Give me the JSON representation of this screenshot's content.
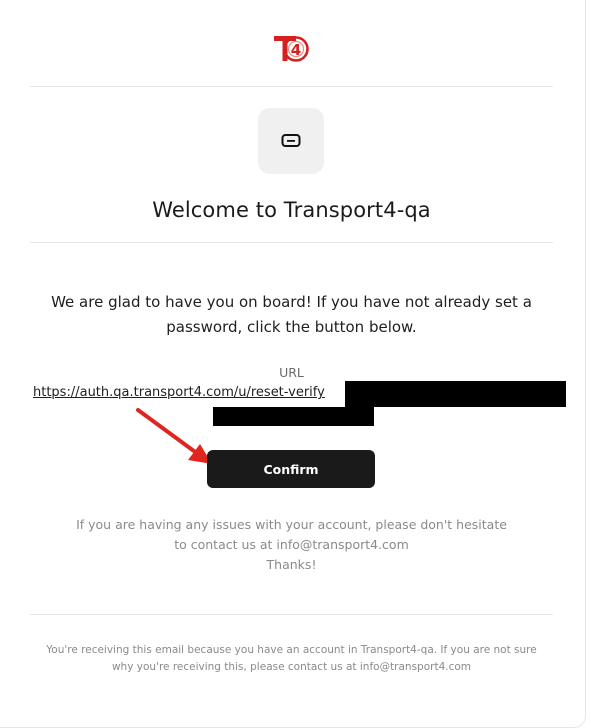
{
  "email": {
    "logo_text": "T4",
    "title": "Welcome to Transport4-qa",
    "intro": "We are glad to have you on board! If you have not already set a password, click the button below.",
    "url_label": "URL",
    "url_text": "https://auth.qa.transport4.com/u/reset-verify",
    "confirm_label": "Confirm",
    "issues_line1": "If you are having any issues with your account, please don't hesitate",
    "issues_line2": "to contact us at info@transport4.com",
    "issues_line3": "Thanks!",
    "footer_line1": "You're receiving this email because you have an account in Transport4-qa. If you are not sure",
    "footer_line2": "why you're receiving this, please contact us at info@transport4.com"
  },
  "icons": {
    "logo": "t4-logo-icon",
    "tile": "chat-bubble-icon",
    "annotation": "red-arrow-icon"
  },
  "colors": {
    "button": "#1a1a1a",
    "arrow": "#e0251f",
    "logo_red": "#d4201e",
    "redaction": "#000000"
  }
}
